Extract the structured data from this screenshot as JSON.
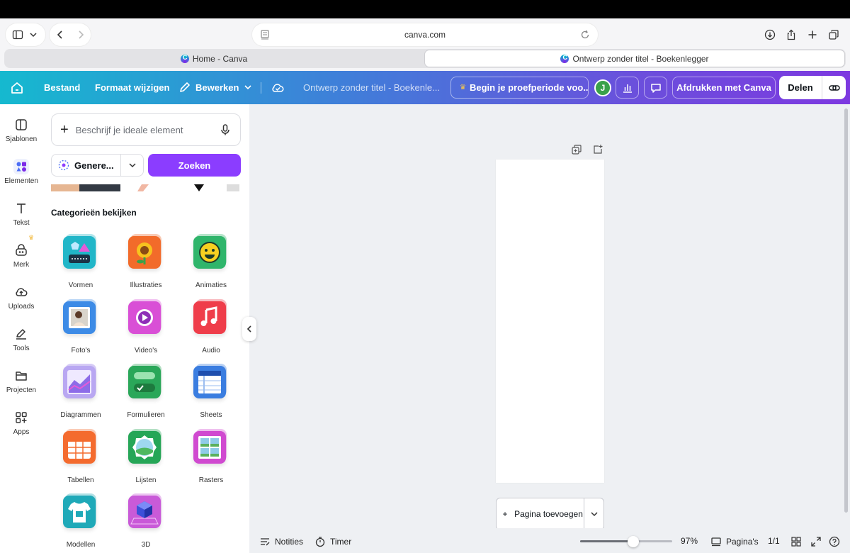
{
  "browser": {
    "address": "canva.com",
    "tabs": [
      {
        "label": "Home - Canva",
        "active": false
      },
      {
        "label": "Ontwerp zonder titel - Boekenlegger",
        "active": true
      }
    ]
  },
  "header": {
    "file": "Bestand",
    "resize": "Formaat wijzigen",
    "edit": "Bewerken",
    "title": "Ontwerp zonder titel - Boekenle...",
    "trial": "Begin je proefperiode voo...",
    "avatar_initial": "J",
    "print": "Afdrukken met Canva",
    "share": "Delen",
    "gradient_colors": [
      "#15b9cf",
      "#7d39e0"
    ]
  },
  "rail": {
    "items": [
      {
        "label": "Sjablonen",
        "icon": "templates-icon"
      },
      {
        "label": "Elementen",
        "icon": "elements-icon",
        "active": true
      },
      {
        "label": "Tekst",
        "icon": "text-icon"
      },
      {
        "label": "Merk",
        "icon": "brand-icon",
        "premium": true
      },
      {
        "label": "Uploads",
        "icon": "upload-icon"
      },
      {
        "label": "Tools",
        "icon": "tools-icon"
      },
      {
        "label": "Projecten",
        "icon": "folder-icon"
      },
      {
        "label": "Apps",
        "icon": "apps-icon"
      }
    ]
  },
  "panel": {
    "search_placeholder": "Beschrijf je ideale element",
    "generate": "Genere...",
    "search_button": "Zoeken",
    "categories_title": "Categorieën bekijken",
    "categories": [
      {
        "label": "Vormen",
        "color": "#21b6c8"
      },
      {
        "label": "Illustraties",
        "color": "#f26b2a"
      },
      {
        "label": "Animaties",
        "color": "#2fb56b"
      },
      {
        "label": "Foto's",
        "color": "#3d8be6"
      },
      {
        "label": "Video's",
        "color": "#d94fd6"
      },
      {
        "label": "Audio",
        "color": "#ef3d4a"
      },
      {
        "label": "Diagrammen",
        "color": "#8d6ce8"
      },
      {
        "label": "Formulieren",
        "color": "#2aa759"
      },
      {
        "label": "Sheets",
        "color": "#3a7de0"
      },
      {
        "label": "Tabellen",
        "color": "#f46b2e"
      },
      {
        "label": "Lijsten",
        "color": "#26a657"
      },
      {
        "label": "Rasters",
        "color": "#d04ad0"
      },
      {
        "label": "Modellen",
        "color": "#1fa9b8"
      },
      {
        "label": "3D",
        "color": "#c95ad8"
      }
    ]
  },
  "canvas": {
    "add_page": "Pagina toevoegen"
  },
  "bottom": {
    "notes": "Notities",
    "timer": "Timer",
    "zoom": "97%",
    "pages": "Pagina's",
    "page_count": "1/1",
    "zoom_level": 0.58
  }
}
